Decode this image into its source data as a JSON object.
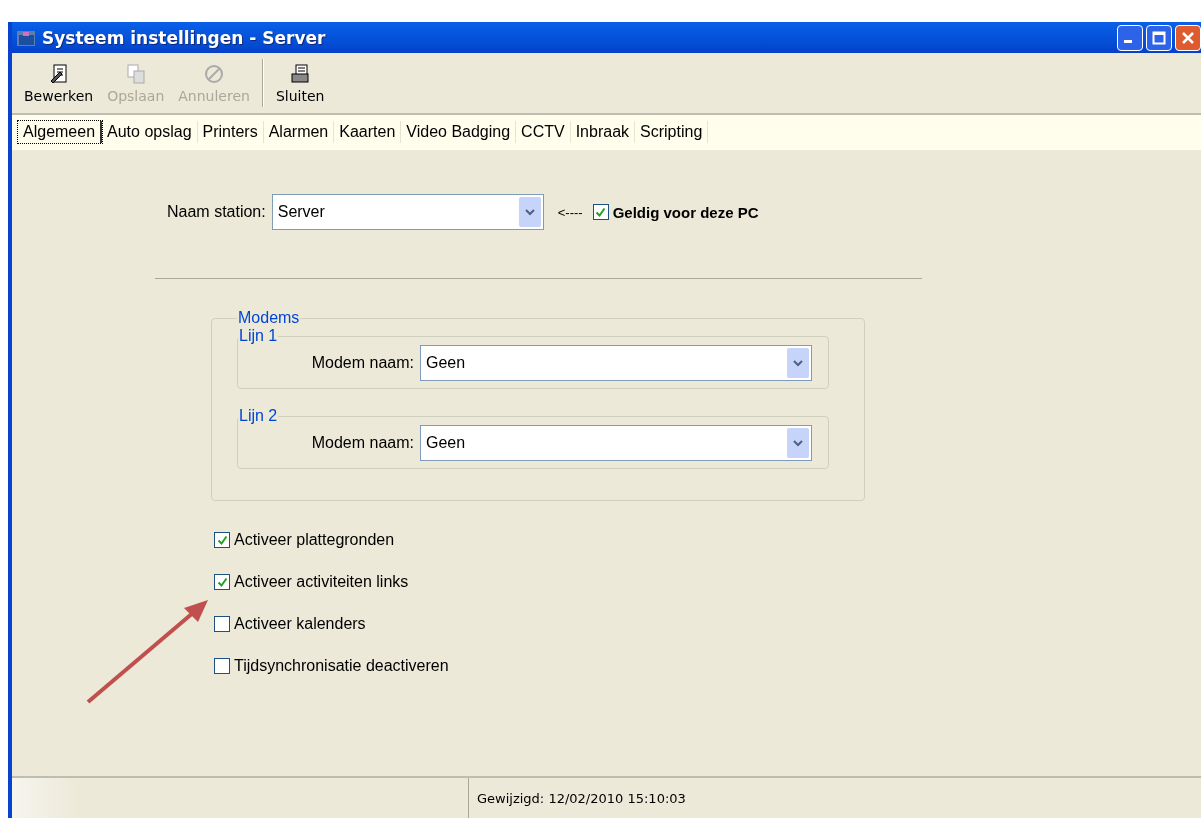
{
  "window": {
    "title": "Systeem instellingen - Server"
  },
  "toolbar": [
    {
      "label": "Bewerken",
      "disabled": false,
      "kind": "edit"
    },
    {
      "label": "Opslaan",
      "disabled": true,
      "kind": "save"
    },
    {
      "label": "Annuleren",
      "disabled": true,
      "kind": "cancel"
    },
    {
      "label": "Sluiten",
      "disabled": false,
      "kind": "close"
    }
  ],
  "tabs": [
    {
      "label": "Algemeen",
      "selected": true
    },
    {
      "label": "Auto opslag",
      "selected": false
    },
    {
      "label": "Printers",
      "selected": false
    },
    {
      "label": "Alarmen",
      "selected": false
    },
    {
      "label": "Kaarten",
      "selected": false
    },
    {
      "label": "Video Badging",
      "selected": false
    },
    {
      "label": "CCTV",
      "selected": false
    },
    {
      "label": "Inbraak",
      "selected": false
    },
    {
      "label": "Scripting",
      "selected": false
    }
  ],
  "station": {
    "label": "Naam station:",
    "value": "Server",
    "pointer": "<----",
    "valid_checkbox": {
      "label": "Geldig voor deze PC",
      "checked": true
    }
  },
  "modems": {
    "title": "Modems",
    "lines": [
      {
        "title": "Lijn 1",
        "label": "Modem naam:",
        "value": "Geen"
      },
      {
        "title": "Lijn 2",
        "label": "Modem naam:",
        "value": "Geen"
      }
    ]
  },
  "options": [
    {
      "label": "Activeer plattegronden",
      "checked": true
    },
    {
      "label": "Activeer activiteiten links",
      "checked": true
    },
    {
      "label": "Activeer kalenders",
      "checked": false
    },
    {
      "label": "Tijdsynchronisatie deactiveren",
      "checked": false
    }
  ],
  "status_bar": {
    "text": "Gewijzigd: 12/02/2010 15:10:03"
  }
}
